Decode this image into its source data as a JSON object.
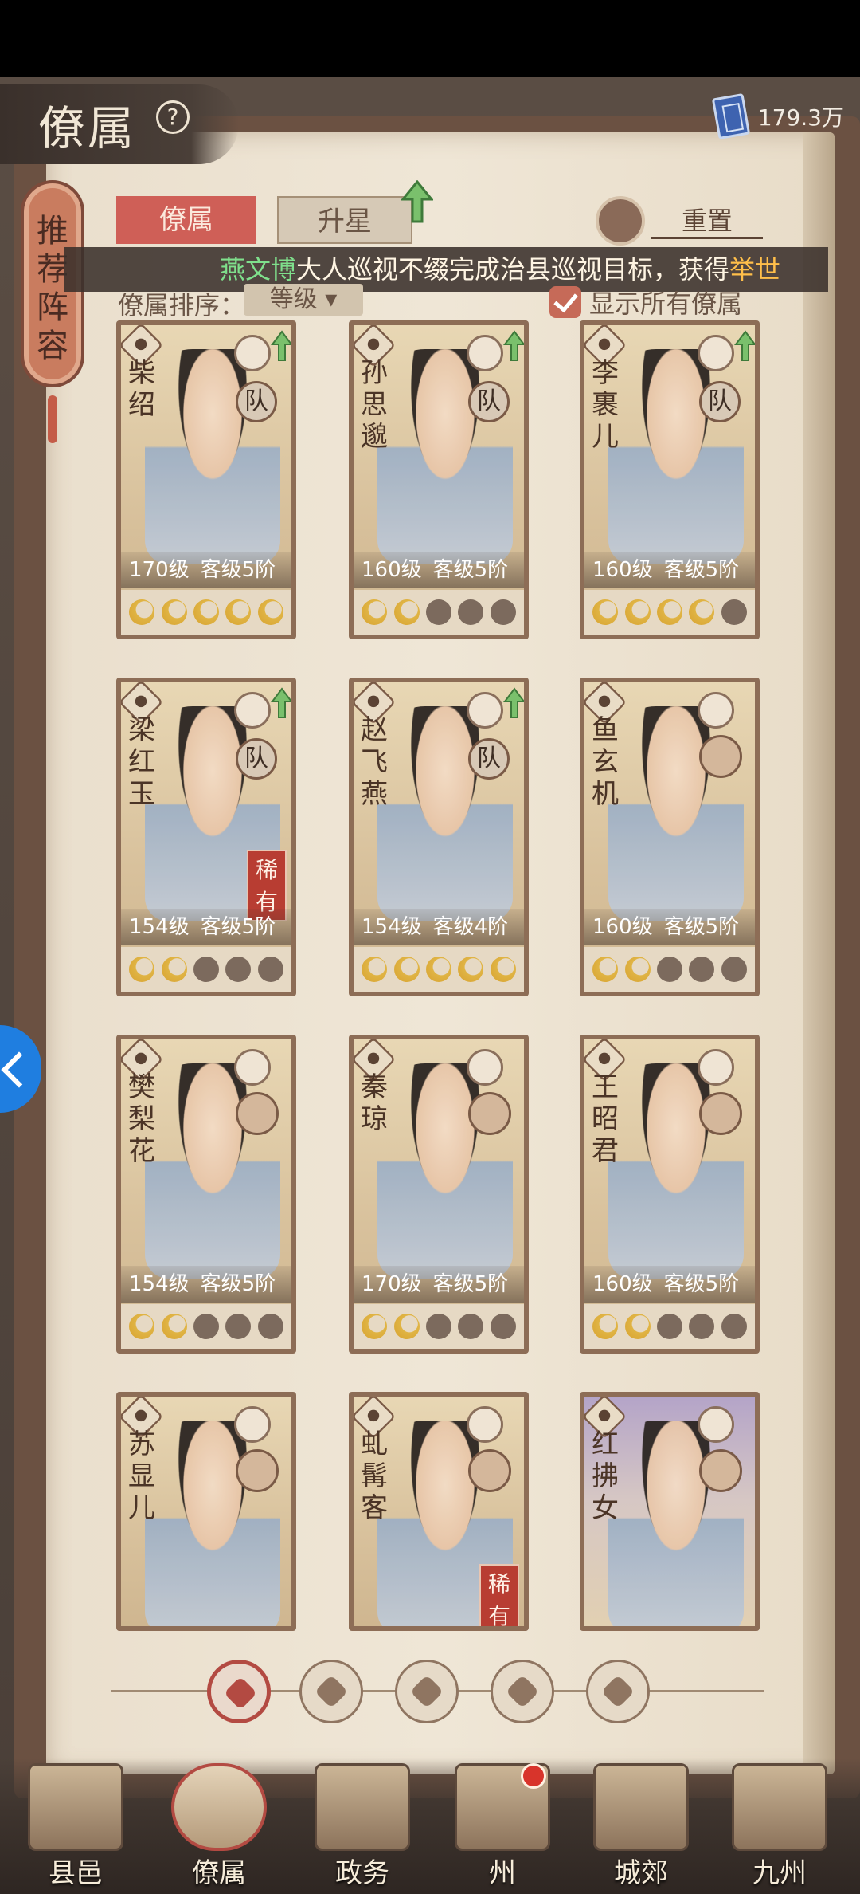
{
  "header": {
    "title": "僚属",
    "currency_value": "179.3万"
  },
  "side_banner": {
    "label": "推荐阵容"
  },
  "tabs": [
    {
      "label": "僚属",
      "active": true
    },
    {
      "label": "升星",
      "active": false
    }
  ],
  "reset_label": "重置",
  "marquee": {
    "name": "燕文博",
    "text": "大人巡视不缀完成治县巡视目标，获得",
    "highlight": "举世"
  },
  "sort": {
    "label": "僚属排序：",
    "value": "等级"
  },
  "show_all": {
    "label": "显示所有僚属",
    "checked": true
  },
  "cards": [
    {
      "name": "柴绍",
      "level": "170级",
      "rank": "客级5阶",
      "stars": 5,
      "team": "队",
      "rare": "",
      "up": true,
      "purple": false
    },
    {
      "name": "孙思邈",
      "level": "160级",
      "rank": "客级5阶",
      "stars": 2,
      "team": "队",
      "rare": "",
      "up": true,
      "purple": false
    },
    {
      "name": "李裹儿",
      "level": "160级",
      "rank": "客级5阶",
      "stars": 4,
      "team": "队",
      "rare": "",
      "up": true,
      "purple": false
    },
    {
      "name": "梁红玉",
      "level": "154级",
      "rank": "客级5阶",
      "stars": 2,
      "team": "队",
      "rare": "稀有",
      "up": true,
      "purple": false
    },
    {
      "name": "赵飞燕",
      "level": "154级",
      "rank": "客级4阶",
      "stars": 5,
      "team": "队",
      "rare": "",
      "up": true,
      "purple": false
    },
    {
      "name": "鱼玄机",
      "level": "160级",
      "rank": "客级5阶",
      "stars": 2,
      "team": "",
      "rare": "",
      "up": false,
      "purple": false
    },
    {
      "name": "樊梨花",
      "level": "154级",
      "rank": "客级5阶",
      "stars": 2,
      "team": "",
      "rare": "",
      "up": false,
      "purple": false
    },
    {
      "name": "秦琼",
      "level": "170级",
      "rank": "客级5阶",
      "stars": 2,
      "team": "",
      "rare": "",
      "up": false,
      "purple": false
    },
    {
      "name": "王昭君",
      "level": "160级",
      "rank": "客级5阶",
      "stars": 2,
      "team": "",
      "rare": "",
      "up": false,
      "purple": false
    },
    {
      "name": "苏显儿",
      "level": "",
      "rank": "",
      "stars": 0,
      "team": "",
      "rare": "",
      "up": false,
      "purple": false
    },
    {
      "name": "虬髯客",
      "level": "",
      "rank": "",
      "stars": 0,
      "team": "",
      "rare": "稀有",
      "up": false,
      "purple": false
    },
    {
      "name": "红拂女",
      "level": "",
      "rank": "",
      "stars": 0,
      "team": "",
      "rare": "",
      "up": false,
      "purple": true
    }
  ],
  "filters": [
    "all-filter-icon",
    "attribute-filter-1-icon",
    "attribute-filter-2-icon",
    "attribute-filter-3-icon",
    "attribute-filter-4-icon"
  ],
  "nav": [
    {
      "label": "县邑",
      "active": false,
      "dot": false
    },
    {
      "label": "僚属",
      "active": true,
      "dot": false
    },
    {
      "label": "政务",
      "active": false,
      "dot": false
    },
    {
      "label": "州",
      "active": false,
      "dot": true
    },
    {
      "label": "城郊",
      "active": false,
      "dot": false
    },
    {
      "label": "九州",
      "active": false,
      "dot": false
    }
  ]
}
